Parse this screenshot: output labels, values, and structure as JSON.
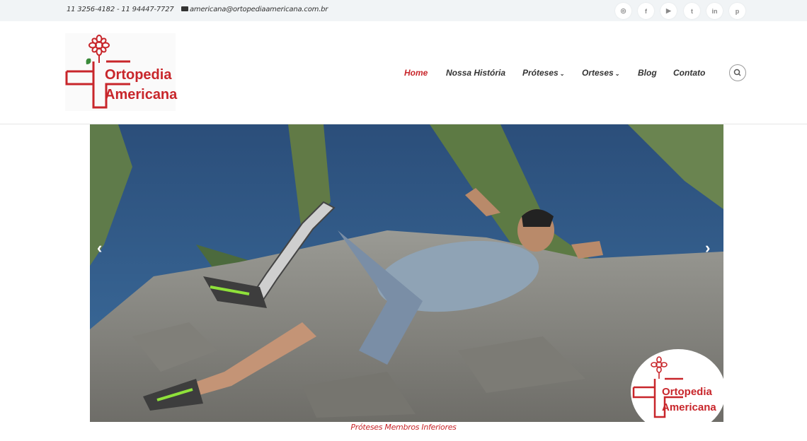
{
  "topbar": {
    "phone": "11  3256-4182 - 11 94447-7727",
    "email": "americana@ortopediaamericana.com.br",
    "socials": [
      {
        "icon": "instagram-icon",
        "glyph": "◎"
      },
      {
        "icon": "facebook-icon",
        "glyph": "f"
      },
      {
        "icon": "youtube-icon",
        "glyph": "▶"
      },
      {
        "icon": "twitter-icon",
        "glyph": "t"
      },
      {
        "icon": "linkedin-icon",
        "glyph": "in"
      },
      {
        "icon": "pinterest-icon",
        "glyph": "p"
      }
    ]
  },
  "logo": {
    "line1": "Ortopedia",
    "line2": "Americana"
  },
  "nav": {
    "home": "Home",
    "history": "Nossa História",
    "proteses": "Próteses",
    "orteses": "Orteses",
    "blog": "Blog",
    "contato": "Contato"
  },
  "slider": {
    "caption": "Próteses Membros Inferiores",
    "badge_line1": "Ortopedia",
    "badge_line2": "Americana"
  },
  "colors": {
    "brand": "#c8262b",
    "topbar": "#f1f4f6"
  }
}
